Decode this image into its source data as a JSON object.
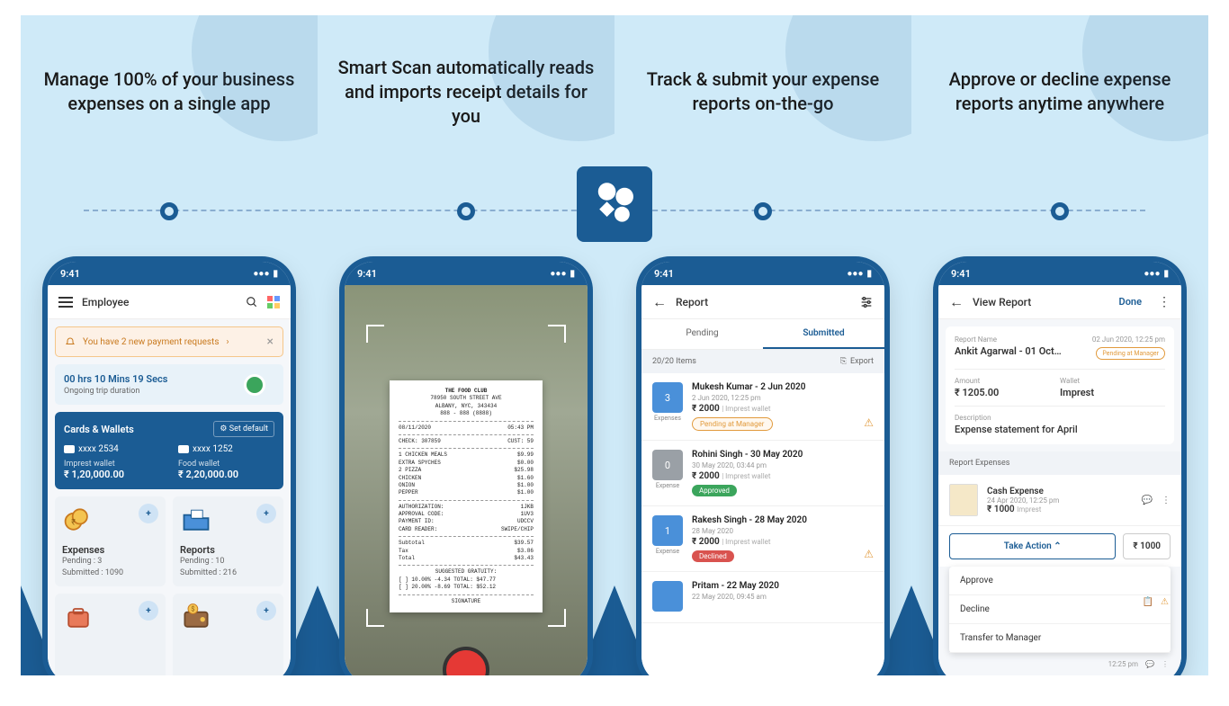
{
  "headlines": [
    "Manage 100% of your business expenses on a single app",
    "Smart Scan automatically reads and imports receipt details for you",
    "Track & submit your expense reports on-the-go",
    "Approve or decline expense reports anytime anywhere"
  ],
  "status_time": "9:41",
  "panel1": {
    "title": "Employee",
    "alert": "You have 2 new payment requests",
    "trip_time": "00 hrs 10 Mins 19 Secs",
    "trip_sub": "Ongoing trip duration",
    "cw_title": "Cards & Wallets",
    "set_default": "Set default",
    "card1": "xxxx 2534",
    "card2": "xxxx 1252",
    "wallet1_label": "Imprest wallet",
    "wallet1_amt": "₹ 1,20,000.00",
    "wallet2_label": "Food wallet",
    "wallet2_amt": "₹ 2,20,000.00",
    "expenses_title": "Expenses",
    "expenses_pending": "Pending : 3",
    "expenses_submitted": "Submitted : 1090",
    "reports_title": "Reports",
    "reports_pending": "Pending : 10",
    "reports_submitted": "Submitted : 216"
  },
  "panel2": {
    "receipt_name": "THE FOOD CLUB",
    "receipt_addr1": "78950 SOUTH STREET AVE",
    "receipt_addr2": "ALBANY, NYC, 343434",
    "receipt_phone": "888 - 888 (8888)",
    "receipt_date": "08/11/2020",
    "receipt_time": "05:43 PM",
    "check": "CHECK: 307859",
    "cust": "CUST: 59",
    "items": [
      {
        "qty": "1",
        "name": "CHICKEN MEALS",
        "price": "$9.99"
      },
      {
        "qty": "",
        "name": "EXTRA SPYCHES",
        "price": "$0.00"
      },
      {
        "qty": "2",
        "name": "PIZZA",
        "price": "$25.98"
      },
      {
        "qty": "",
        "name": "CHICKEN",
        "price": "$1.60"
      },
      {
        "qty": "",
        "name": "ONION",
        "price": "$1.00"
      },
      {
        "qty": "",
        "name": "PEPPER",
        "price": "$1.00"
      }
    ],
    "auth": "AUTHORIZATION:",
    "auth_v": "1JKB",
    "appr": "APPROVAL CODE:",
    "appr_v": "1UV3",
    "pay": "PAYMENT ID:",
    "pay_v": "UDCCV",
    "reader": "CARD READER:",
    "reader_v": "SWIPE/CHIP",
    "subtotal_l": "Subtotal",
    "subtotal_v": "$39.57",
    "tax_l": "Tax",
    "tax_v": "$3.86",
    "total_l": "Total",
    "total_v": "$43.43",
    "gratuity": "SUGGESTED GRATUITY:",
    "g1": "[ ] 10.00% -4.34   TOTAL: $47.77",
    "g2": "[ ] 20.00% -8.69   TOTAL: $52.12",
    "sig": "SIGNATURE"
  },
  "panel3": {
    "title": "Report",
    "tab_pending": "Pending",
    "tab_submitted": "Submitted",
    "items_count": "20/20 Items",
    "export": "Export",
    "rows": [
      {
        "title": "Mukesh Kumar - 2 Jun 2020",
        "date": "2 Jun 2020, 12:25 pm",
        "amount": "₹ 2000",
        "wallet": "Imprest wallet",
        "badge": "Pending at Manager",
        "badge_type": "pending",
        "count": "3",
        "label": "Expenses",
        "gray": false,
        "warn": true
      },
      {
        "title": "Rohini Singh - 30 May 2020",
        "date": "30 May 2020, 03:44 pm",
        "amount": "₹ 2000",
        "wallet": "Imprest wallet",
        "badge": "Approved",
        "badge_type": "approved",
        "count": "0",
        "label": "Expense",
        "gray": true,
        "warn": false
      },
      {
        "title": "Rakesh Singh - 28 May 2020",
        "date": "28 May 2020",
        "amount": "₹ 2000",
        "wallet": "Imprest wallet",
        "badge": "Declined",
        "badge_type": "declined",
        "count": "1",
        "label": "Expense",
        "gray": false,
        "warn": true
      },
      {
        "title": "Pritam - 22 May 2020",
        "date": "22 May 2020, 09:45 am",
        "amount": "",
        "wallet": "",
        "badge": "",
        "badge_type": "",
        "count": "",
        "label": "",
        "gray": false,
        "warn": false
      }
    ]
  },
  "panel4": {
    "title": "View Report",
    "done": "Done",
    "rn_label": "Report Name",
    "rn_date": "02 Jun 2020, 12:25 pm",
    "rn_value": "Ankit Agarwal - 01 Oct…",
    "rn_badge": "Pending at Manager",
    "amount_label": "Amount",
    "amount_value": "₹ 1205.00",
    "wallet_label": "Wallet",
    "wallet_value": "Imprest",
    "desc_label": "Description",
    "desc_value": "Expense statement for April",
    "sect": "Report Expenses",
    "exp_title": "Cash Expense",
    "exp_date": "24 Apr 2020, 12:25 pm",
    "exp_amt": "₹ 1000",
    "exp_wallet": "Imprest",
    "take_action": "Take Action",
    "amt_box": "₹ 1000",
    "dd1": "Approve",
    "dd2": "Decline",
    "dd3": "Transfer to Manager",
    "peek_date": "12:25 pm"
  }
}
